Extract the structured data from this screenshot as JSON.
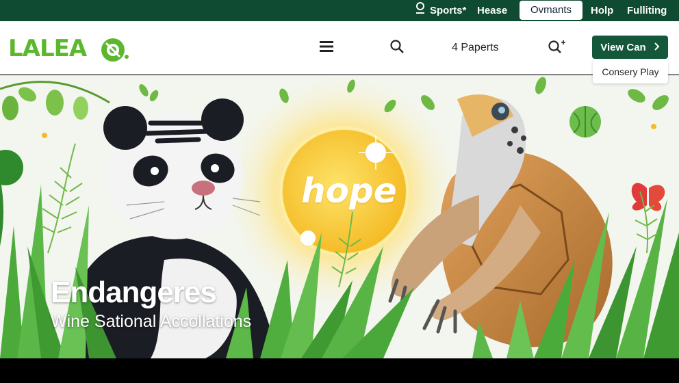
{
  "topbar": {
    "items": [
      {
        "label": "Sports*",
        "icon": "pin-icon"
      },
      {
        "label": "Hease"
      },
      {
        "label": "Ovmants",
        "active": true
      },
      {
        "label": "Holp"
      },
      {
        "label": "Fulliting"
      }
    ]
  },
  "header": {
    "logo_text": "LALEA",
    "nav_papers_label": "4 Paperts",
    "cta_label": "View Can",
    "dropdown_label": "Consery Play"
  },
  "hero": {
    "title": "Endangeres",
    "subtitle": "Wine Sational Accollations",
    "sun_label": "hope"
  },
  "colors": {
    "topbar_bg": "#0f4a32",
    "brand_green": "#5bb82e",
    "cta_bg": "#14573a",
    "sun_yellow": "#f7c531"
  }
}
